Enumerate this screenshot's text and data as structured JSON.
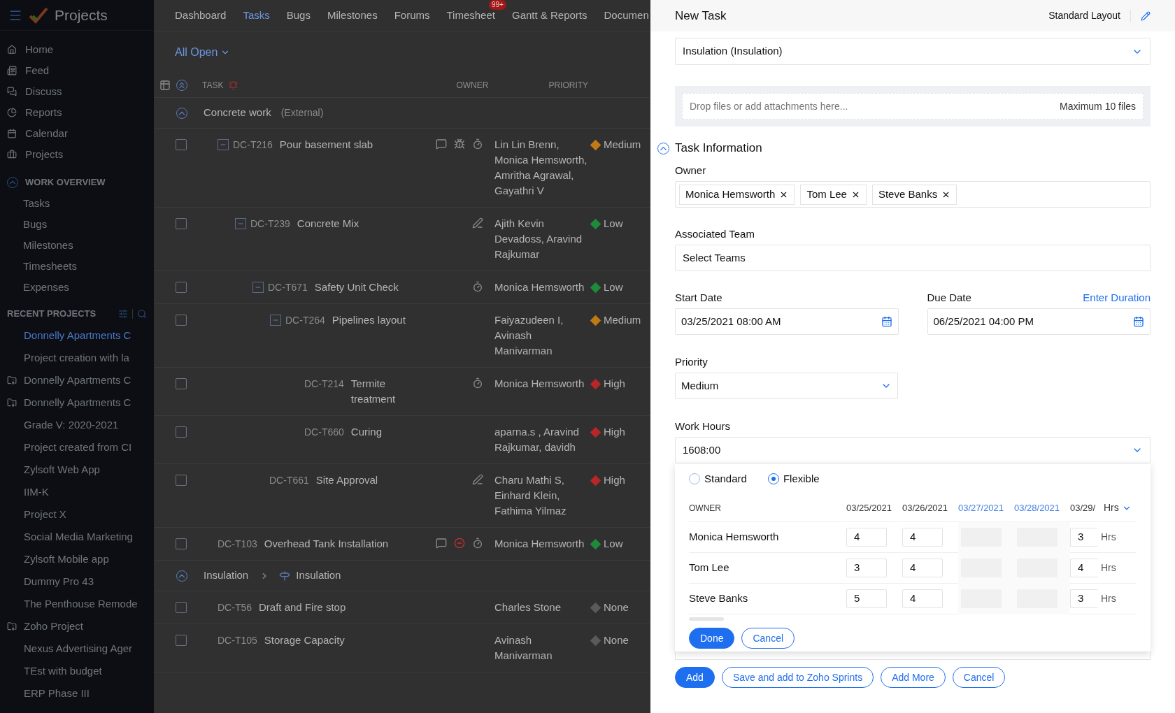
{
  "app": {
    "name": "Projects"
  },
  "sidebar": {
    "nav": [
      {
        "label": "Home"
      },
      {
        "label": "Feed"
      },
      {
        "label": "Discuss"
      },
      {
        "label": "Reports"
      },
      {
        "label": "Calendar"
      },
      {
        "label": "Projects"
      }
    ],
    "work_overview": {
      "title": "WORK OVERVIEW",
      "expanded": true,
      "items": [
        "Tasks",
        "Bugs",
        "Milestones",
        "Timesheets",
        "Expenses"
      ]
    },
    "recent_projects": {
      "title": "RECENT PROJECTS",
      "items": [
        {
          "label": "Donnelly Apartments C",
          "selected": true,
          "kind": "plain"
        },
        {
          "label": "Project creation with la",
          "selected": false,
          "kind": "plain"
        },
        {
          "label": "Donnelly Apartments C",
          "selected": false,
          "kind": "template"
        },
        {
          "label": "Donnelly Apartments C",
          "selected": false,
          "kind": "template"
        },
        {
          "label": "Grade V: 2020-2021",
          "selected": false,
          "kind": "plain"
        },
        {
          "label": "Project created from CI",
          "selected": false,
          "kind": "plain"
        },
        {
          "label": "Zylsoft Web App",
          "selected": false,
          "kind": "plain"
        },
        {
          "label": "IIM-K",
          "selected": false,
          "kind": "plain"
        },
        {
          "label": "Project X",
          "selected": false,
          "kind": "plain"
        },
        {
          "label": "Social Media Marketing",
          "selected": false,
          "kind": "plain"
        },
        {
          "label": "Zylsoft Mobile app",
          "selected": false,
          "kind": "plain"
        },
        {
          "label": "Dummy Pro 43",
          "selected": false,
          "kind": "plain"
        },
        {
          "label": "The Penthouse Remode",
          "selected": false,
          "kind": "plain"
        },
        {
          "label": "Zoho Project",
          "selected": false,
          "kind": "template"
        },
        {
          "label": "Nexus Advertising Ager",
          "selected": false,
          "kind": "plain"
        },
        {
          "label": "TEst with budget",
          "selected": false,
          "kind": "plain"
        },
        {
          "label": "ERP Phase III",
          "selected": false,
          "kind": "plain"
        }
      ]
    }
  },
  "tabs": [
    {
      "label": "Dashboard",
      "selected": false
    },
    {
      "label": "Tasks",
      "selected": true
    },
    {
      "label": "Bugs",
      "selected": false
    },
    {
      "label": "Milestones",
      "selected": false
    },
    {
      "label": "Forums",
      "selected": false
    },
    {
      "label": "Timesheet",
      "selected": false,
      "badge": "99+"
    },
    {
      "label": "Gantt & Reports",
      "selected": false
    },
    {
      "label": "Documen",
      "selected": false
    }
  ],
  "filter": "All Open",
  "table": {
    "columns": [
      "TASK",
      "OWNER",
      "PRIORITY"
    ],
    "groups": [
      {
        "name": "Concrete work",
        "suffix": "(External)",
        "expanded": true,
        "rows": [
          {
            "checked": false,
            "id": "DC-T216",
            "title": "Pour basement slab",
            "comment": true,
            "bug": true,
            "timer": true,
            "owner": "Lin Lin Brenn, Monica Hemsworth, Amritha Agrawal, Gayathri V",
            "priority": "Medium",
            "color": "#c07a14",
            "expanded": true,
            "children": [
              {
                "checked": false,
                "id": "DC-T239",
                "title": "Concrete Mix",
                "pen": true,
                "owner": "Ajith Kevin Devadoss, Aravind Rajkumar",
                "priority": "Low",
                "color": "#1f8a3a",
                "expanded": true,
                "children": [
                  {
                    "checked": false,
                    "id": "DC-T671",
                    "title": "Safety Unit Check",
                    "timer": true,
                    "owner": "Monica Hemsworth",
                    "priority": "Low",
                    "color": "#1f8a3a",
                    "expanded": true,
                    "children": [
                      {
                        "checked": false,
                        "id": "DC-T264",
                        "title": "Pipelines layout",
                        "owner": "Faiyazudeen I, Avinash Manivarman",
                        "priority": "Medium",
                        "color": "#c07a14",
                        "expanded": true,
                        "children": [
                          {
                            "checked": false,
                            "id": "DC-T214",
                            "title": "Termite treatment",
                            "timer": true,
                            "owner": "Monica Hemsworth",
                            "priority": "High",
                            "color": "#b82626"
                          },
                          {
                            "checked": false,
                            "id": "DC-T660",
                            "title": "Curing",
                            "owner": "aparna.s , Aravind Rajkumar, davidh",
                            "priority": "High",
                            "color": "#b82626"
                          }
                        ]
                      }
                    ]
                  },
                  {
                    "checked": false,
                    "id": "DC-T661",
                    "title": "Site Approval",
                    "pen": true,
                    "owner": "Charu Mathi S, Einhard Klein, Fathima Yilmaz",
                    "priority": "High",
                    "color": "#b82626"
                  }
                ]
              }
            ]
          },
          {
            "checked": false,
            "id": "DC-T103",
            "title": "Overhead Tank Installation",
            "comment": true,
            "blocked": true,
            "timer": true,
            "owner": "Monica Hemsworth",
            "priority": "Low",
            "color": "#1f8a3a"
          }
        ]
      },
      {
        "name": "Insulation",
        "sublist": "Insulation",
        "expanded": true,
        "rows": [
          {
            "checked": false,
            "id": "DC-T56",
            "title": "Draft and Fire stop",
            "owner": "Charles Stone",
            "priority": "None",
            "color": "#5a5a5a"
          },
          {
            "checked": false,
            "id": "DC-T105",
            "title": "Storage Capacity",
            "owner": "Avinash Manivarman",
            "priority": "None",
            "color": "#5a5a5a"
          }
        ]
      }
    ]
  },
  "panel": {
    "title": "New Task",
    "layout": "Standard Layout",
    "task_list": {
      "value": "Insulation (Insulation)"
    },
    "attachments": {
      "placeholder": "Drop files or add attachments here...",
      "limit": "Maximum 10 files"
    },
    "section": {
      "title": "Task Information",
      "expanded": true
    },
    "owner": {
      "label": "Owner",
      "tags": [
        "Monica Hemsworth",
        "Tom Lee",
        "Steve Banks"
      ]
    },
    "team": {
      "label": "Associated Team",
      "value": "Select Teams"
    },
    "start": {
      "label": "Start Date",
      "value": "03/25/2021 08:00 AM"
    },
    "due": {
      "label": "Due Date",
      "link": "Enter Duration",
      "value": "06/25/2021 04:00 PM"
    },
    "priority": {
      "label": "Priority",
      "value": "Medium"
    },
    "work_hours": {
      "label": "Work Hours",
      "value": "1608:00",
      "popup": {
        "modes": [
          {
            "label": "Standard",
            "selected": false
          },
          {
            "label": "Flexible",
            "selected": true
          }
        ],
        "owner_heading": "OWNER",
        "dates": [
          {
            "label": "03/25/2021",
            "weekend": false
          },
          {
            "label": "03/26/2021",
            "weekend": false
          },
          {
            "label": "03/27/2021",
            "weekend": true
          },
          {
            "label": "03/28/2021",
            "weekend": true
          },
          {
            "label": "03/29/",
            "weekend": false
          }
        ],
        "unit_heading": "Hrs",
        "rows": [
          {
            "name": "Monica Hemsworth",
            "cells": [
              "4",
              "4",
              null,
              null,
              "3"
            ],
            "unit": "Hrs"
          },
          {
            "name": "Tom Lee",
            "cells": [
              "3",
              "4",
              null,
              null,
              "4"
            ],
            "unit": "Hrs"
          },
          {
            "name": "Steve Banks",
            "cells": [
              "5",
              "4",
              null,
              null,
              "3"
            ],
            "unit": "Hrs"
          }
        ],
        "buttons": [
          {
            "label": "Done",
            "kind": "primary"
          },
          {
            "label": "Cancel",
            "kind": "outline"
          }
        ]
      }
    },
    "footer": [
      {
        "label": "Add",
        "kind": "primary"
      },
      {
        "label": "Save and add to Zoho Sprints",
        "kind": "outline"
      },
      {
        "label": "Add More",
        "kind": "outline"
      },
      {
        "label": "Cancel",
        "kind": "outline"
      }
    ]
  }
}
